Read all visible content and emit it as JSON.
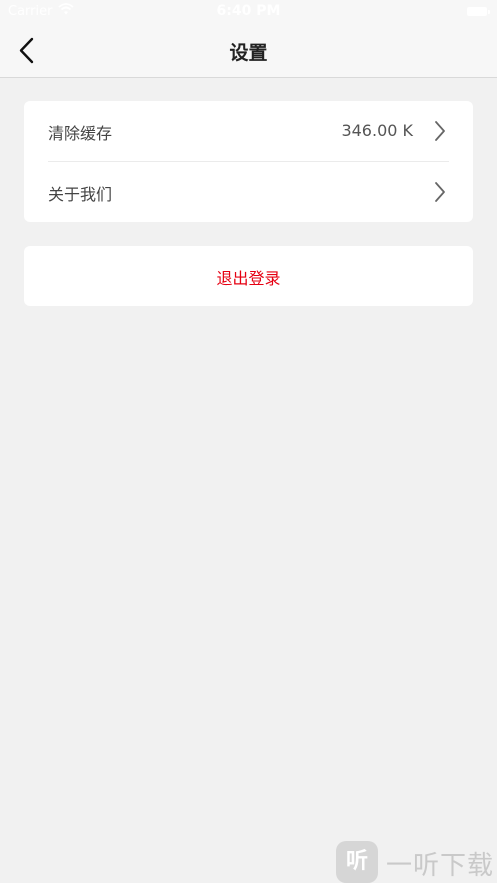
{
  "status_bar": {
    "carrier": "Carrier",
    "time": "6:40 PM"
  },
  "nav": {
    "title": "设置"
  },
  "settings": {
    "items": [
      {
        "label": "清除缓存",
        "value": "346.00 K"
      },
      {
        "label": "关于我们",
        "value": ""
      }
    ]
  },
  "logout": {
    "label": "退出登录"
  },
  "colors": {
    "background": "#f1f1f1",
    "nav_background": "#f7f7f7",
    "card": "#ffffff",
    "logout_text": "#e60012"
  },
  "icons": {
    "back": "chevron-left-icon",
    "row_arrow": "chevron-right-icon",
    "wifi": "wifi-icon",
    "battery": "battery-icon"
  },
  "watermark": {
    "logo_text": "听",
    "text": "一听下载"
  }
}
